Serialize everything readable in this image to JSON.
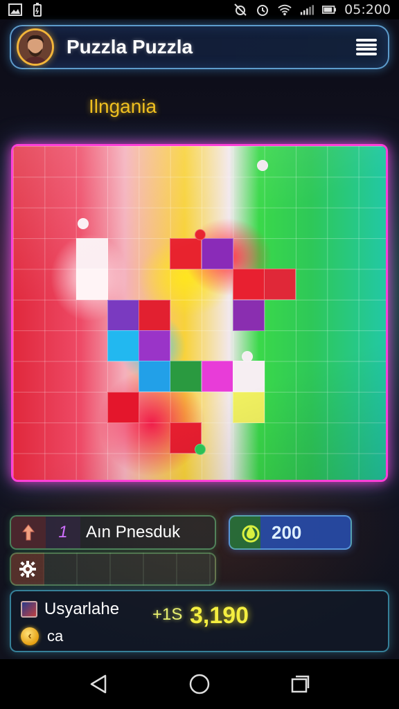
{
  "status_bar": {
    "time": "05:200",
    "left_icons": [
      "image-icon",
      "battery-saver-icon"
    ],
    "right_icons": [
      "alarm-off-icon",
      "alarm-icon",
      "wifi-icon",
      "signal-icon",
      "battery-icon"
    ]
  },
  "header": {
    "title": "Puzzla Puzzla",
    "avatar_icon": "player-avatar",
    "menu_icon": "hamburger-menu-icon"
  },
  "level": {
    "name": "Ilngania"
  },
  "hint_bar": {
    "icon": "arrow-up-icon",
    "count": "1",
    "label": "Aın Pnesduk"
  },
  "coins": {
    "icon": "drop-icon",
    "value": "200"
  },
  "settings": {
    "icon": "gear-icon"
  },
  "player": {
    "name": "Usyarlahe",
    "currency_label": "ca",
    "score_bonus": "+1S",
    "score": "3,190"
  },
  "nav": {
    "back_icon": "back-triangle-icon",
    "home_icon": "home-circle-icon",
    "recents_icon": "recents-square-icon"
  },
  "colors": {
    "board_border": "#ff40d8",
    "level_name": "#f0c020",
    "score": "#f4ee40",
    "coins_bg": "#2850b4"
  }
}
